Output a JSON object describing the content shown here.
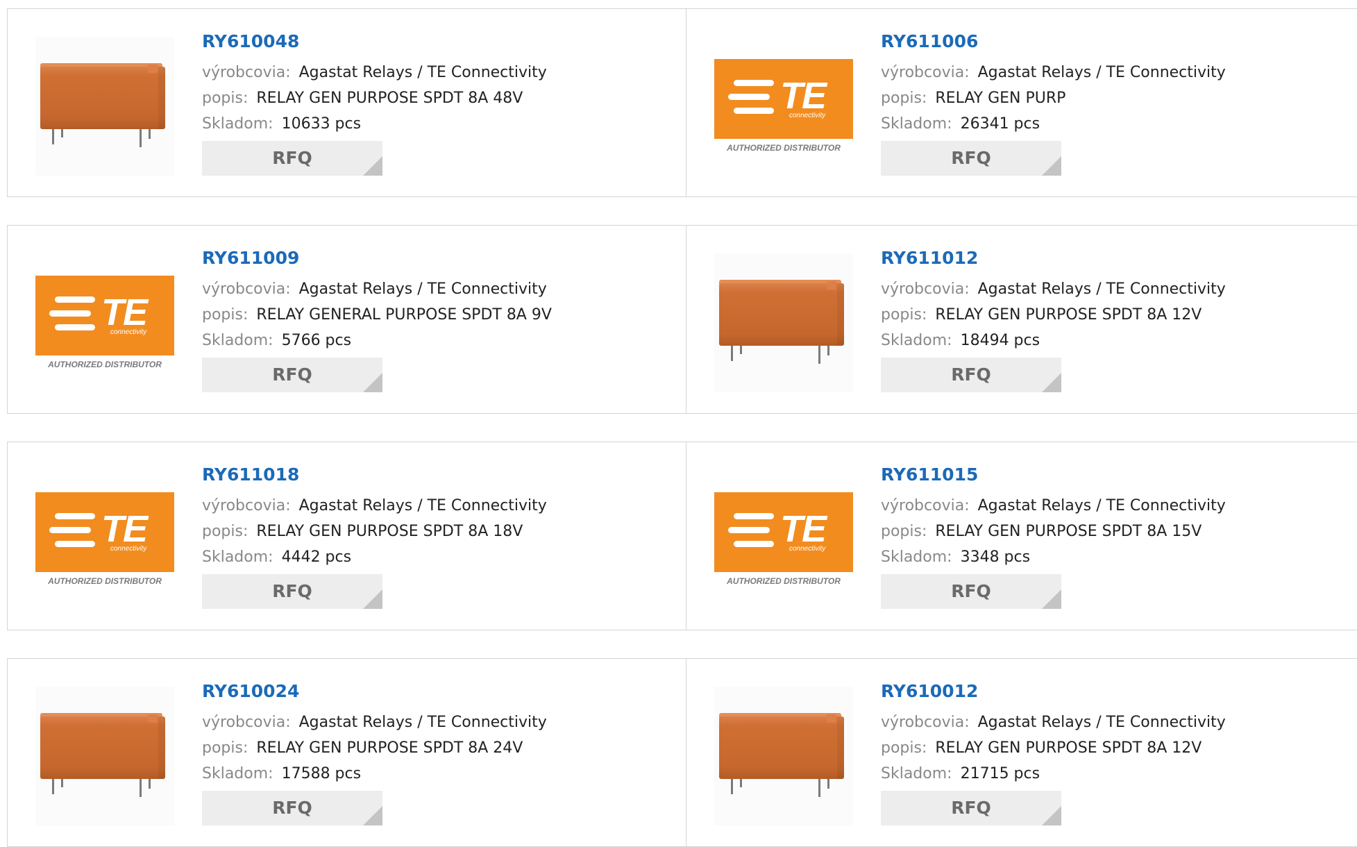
{
  "labels": {
    "manufacturer": "výrobcovia:",
    "description": "popis:",
    "stock": "Skladom:",
    "rfq": "RFQ"
  },
  "te_logo": {
    "letters": "TE",
    "sub": "connectivity",
    "caption": "AUTHORIZED DISTRIBUTOR",
    "color": "#f28c1f"
  },
  "colors": {
    "part_link": "#1b6ab8",
    "label": "#888888",
    "rfq_bg": "#ededed"
  },
  "products": [
    {
      "part": "RY610048",
      "image": "relay-image",
      "manufacturer": "Agastat Relays / TE Connectivity",
      "description": "RELAY GEN PURPOSE SPDT 8A 48V",
      "stock": "10633 pcs"
    },
    {
      "part": "RY611006",
      "image": "te-logo",
      "manufacturer": "Agastat Relays / TE Connectivity",
      "description": "RELAY GEN PURP",
      "stock": "26341 pcs"
    },
    {
      "part": "RY611009",
      "image": "te-logo",
      "manufacturer": "Agastat Relays / TE Connectivity",
      "description": "RELAY GENERAL PURPOSE SPDT 8A 9V",
      "stock": "5766 pcs"
    },
    {
      "part": "RY611012",
      "image": "relay-image",
      "manufacturer": "Agastat Relays / TE Connectivity",
      "description": "RELAY GEN PURPOSE SPDT 8A 12V",
      "stock": "18494 pcs"
    },
    {
      "part": "RY611018",
      "image": "te-logo",
      "manufacturer": "Agastat Relays / TE Connectivity",
      "description": "RELAY GEN PURPOSE SPDT 8A 18V",
      "stock": "4442 pcs"
    },
    {
      "part": "RY611015",
      "image": "te-logo",
      "manufacturer": "Agastat Relays / TE Connectivity",
      "description": "RELAY GEN PURPOSE SPDT 8A 15V",
      "stock": "3348 pcs"
    },
    {
      "part": "RY610024",
      "image": "relay-image",
      "manufacturer": "Agastat Relays / TE Connectivity",
      "description": "RELAY GEN PURPOSE SPDT 8A 24V",
      "stock": "17588 pcs"
    },
    {
      "part": "RY610012",
      "image": "relay-image",
      "manufacturer": "Agastat Relays / TE Connectivity",
      "description": "RELAY GEN PURPOSE SPDT 8A 12V",
      "stock": "21715 pcs"
    }
  ]
}
